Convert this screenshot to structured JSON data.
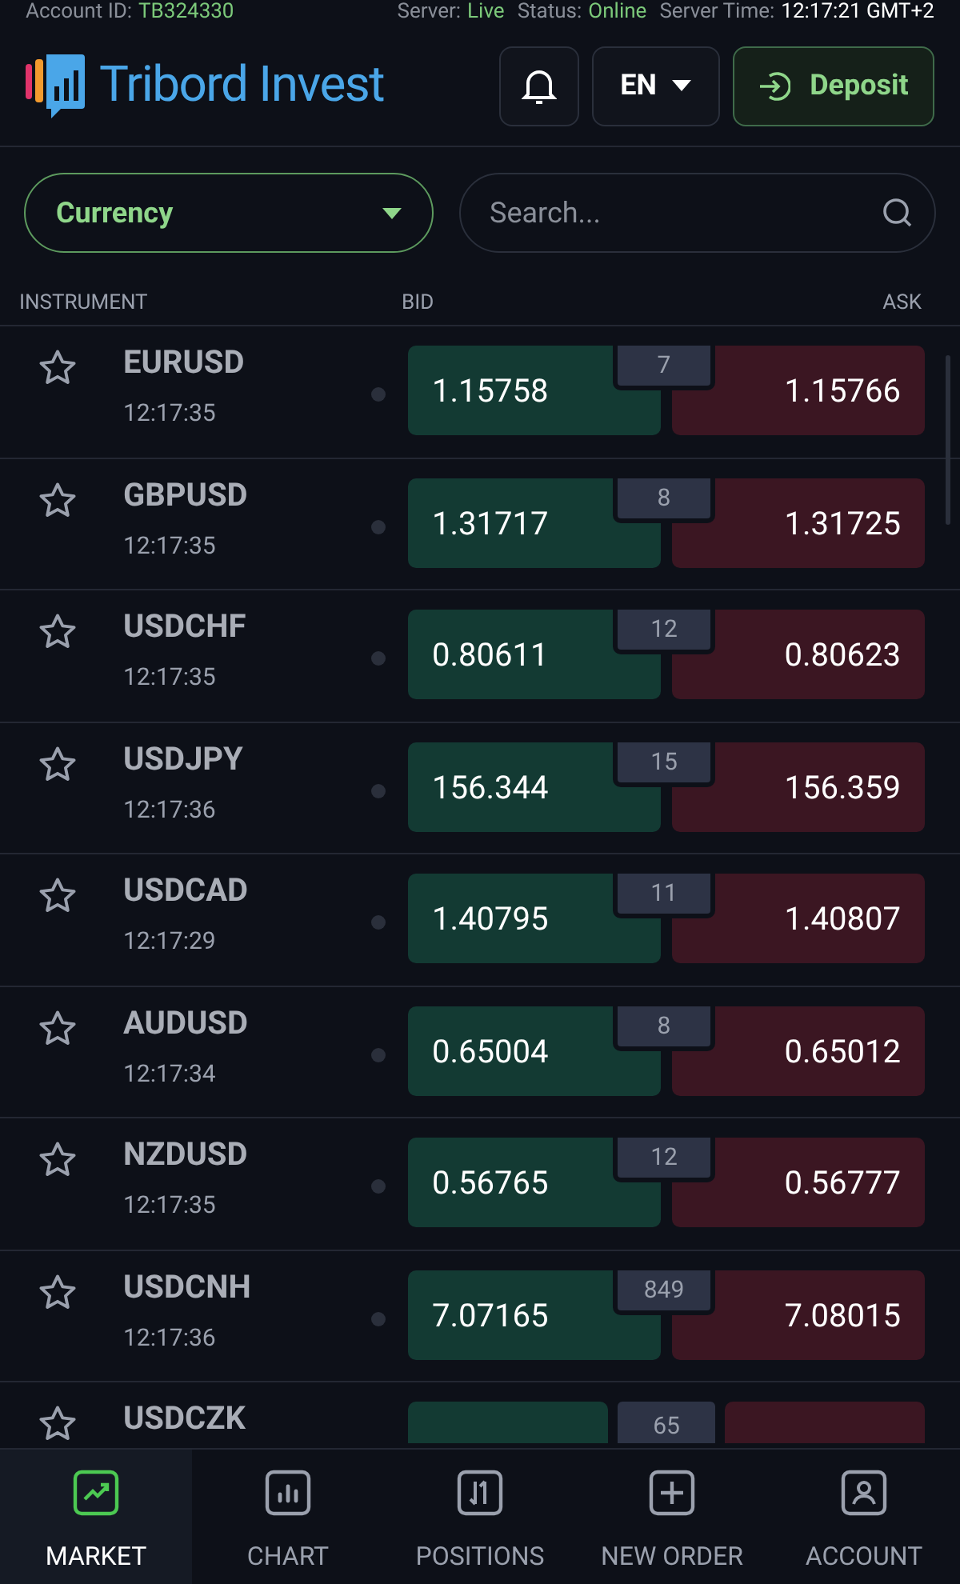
{
  "status_line": {
    "account_label": "Account ID:",
    "account_id": "TB324330",
    "server_label": "Server:",
    "server": "Live",
    "status_label": "Status:",
    "status": "Online",
    "time_label": "Server Time:",
    "time": "12:17:21 GMT+2"
  },
  "header": {
    "brand": "Tribord Invest",
    "language": "EN",
    "deposit": "Deposit"
  },
  "filter": {
    "category": "Currency",
    "search_placeholder": "Search..."
  },
  "columns": [
    "INSTRUMENT",
    "BID",
    "ASK"
  ],
  "rows": [
    {
      "symbol": "EURUSD",
      "time": "12:17:35",
      "bid": "1.15758",
      "spread": "7",
      "ask": "1.15766"
    },
    {
      "symbol": "GBPUSD",
      "time": "12:17:35",
      "bid": "1.31717",
      "spread": "8",
      "ask": "1.31725"
    },
    {
      "symbol": "USDCHF",
      "time": "12:17:35",
      "bid": "0.80611",
      "spread": "12",
      "ask": "0.80623"
    },
    {
      "symbol": "USDJPY",
      "time": "12:17:36",
      "bid": "156.344",
      "spread": "15",
      "ask": "156.359"
    },
    {
      "symbol": "USDCAD",
      "time": "12:17:29",
      "bid": "1.40795",
      "spread": "11",
      "ask": "1.40807"
    },
    {
      "symbol": "AUDUSD",
      "time": "12:17:34",
      "bid": "0.65004",
      "spread": "8",
      "ask": "0.65012"
    },
    {
      "symbol": "NZDUSD",
      "time": "12:17:35",
      "bid": "0.56765",
      "spread": "12",
      "ask": "0.56777"
    },
    {
      "symbol": "USDCNH",
      "time": "12:17:36",
      "bid": "7.07165",
      "spread": "849",
      "ask": "7.08015"
    },
    {
      "symbol": "USDCZK",
      "spread": "65"
    }
  ],
  "nav": [
    {
      "kind": "market",
      "label": "MARKET",
      "selected": true
    },
    {
      "kind": "chart",
      "label": "CHART",
      "selected": false
    },
    {
      "kind": "positions",
      "label": "POSITIONS",
      "selected": false
    },
    {
      "kind": "order",
      "label": "NEW ORDER",
      "selected": false
    },
    {
      "kind": "account",
      "label": "ACCOUNT",
      "selected": false
    }
  ]
}
